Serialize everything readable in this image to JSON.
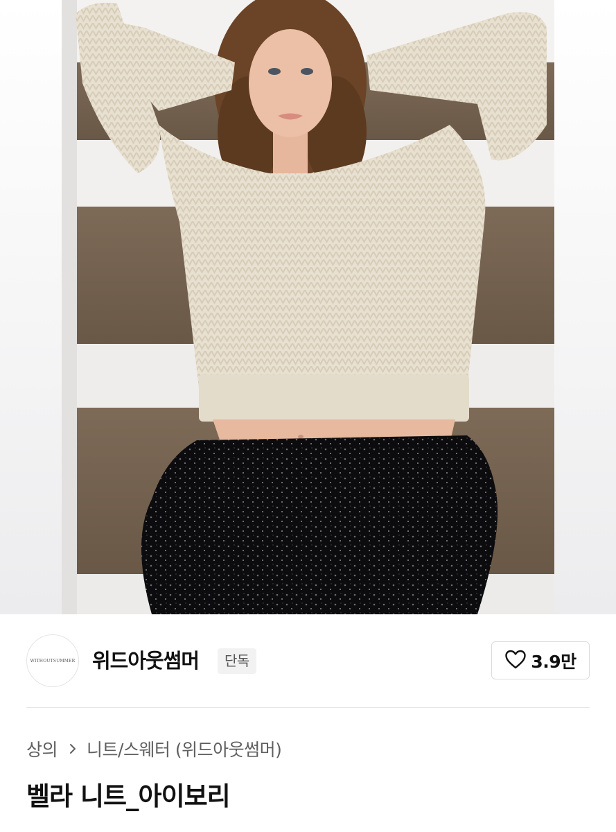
{
  "brand": {
    "logo_text": "WITHOUTSUMMER",
    "name": "위드아웃썸머",
    "badge": "단독"
  },
  "like": {
    "icon": "heart-icon",
    "count": "3.9만"
  },
  "breadcrumb": {
    "category": "상의",
    "separator_icon": "chevron-right-icon",
    "subcategory": "니트/스웨터 (위드아웃썸머)"
  },
  "product": {
    "title": "벨라 니트_아이보리"
  },
  "colors": {
    "text_primary": "#111111",
    "text_secondary": "#5f5f5f",
    "badge_bg": "#f2f2f2",
    "border": "#dcdcdc"
  }
}
